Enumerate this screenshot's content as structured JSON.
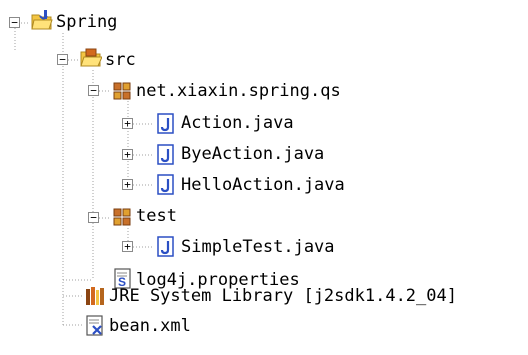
{
  "tree": {
    "project": {
      "label": "Spring",
      "icon": "java-project-folder-icon"
    },
    "src": {
      "label": "src",
      "icon": "source-folder-icon"
    },
    "pkg_qs": {
      "label": "net.xiaxin.spring.qs",
      "icon": "package-icon"
    },
    "file_action": {
      "label": "Action.java",
      "icon": "java-file-icon"
    },
    "file_bye": {
      "label": "ByeAction.java",
      "icon": "java-file-icon"
    },
    "file_hello": {
      "label": "HelloAction.java",
      "icon": "java-file-icon"
    },
    "pkg_test": {
      "label": "test",
      "icon": "package-icon"
    },
    "file_simple": {
      "label": "SimpleTest.java",
      "icon": "java-file-icon"
    },
    "file_log4j": {
      "label": "log4j.properties",
      "icon": "properties-file-icon"
    },
    "jre": {
      "label": "JRE System Library [j2sdk1.4.2_04]",
      "icon": "library-icon"
    },
    "bean": {
      "label": "bean.xml",
      "icon": "xml-file-icon"
    }
  },
  "colors": {
    "guide": "#a0a0a0",
    "java_blue": "#2b4fc4",
    "folder_yellow": "#f4c542",
    "package_brown": "#b5651d"
  }
}
